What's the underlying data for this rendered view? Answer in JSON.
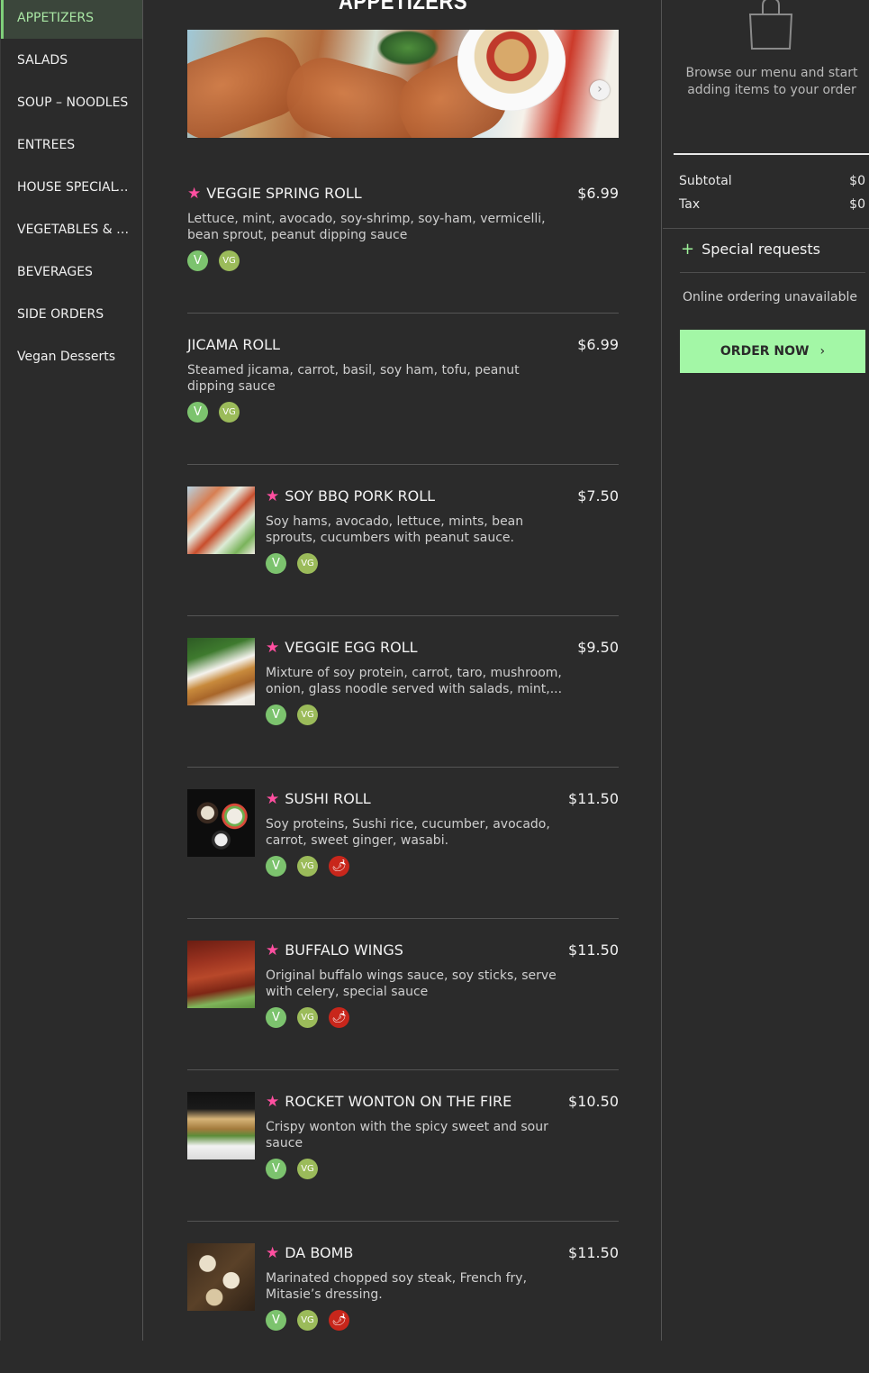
{
  "sidebar": {
    "items": [
      {
        "label": "APPETIZERS"
      },
      {
        "label": "SALADS"
      },
      {
        "label": "SOUP – NOODLES"
      },
      {
        "label": "ENTREES"
      },
      {
        "label": "HOUSE SPECIALTIES"
      },
      {
        "label": "VEGETABLES & TOFU"
      },
      {
        "label": "BEVERAGES"
      },
      {
        "label": "SIDE ORDERS"
      },
      {
        "label": "Vegan Desserts"
      }
    ]
  },
  "section": {
    "title": "APPETIZERS"
  },
  "menu_items": [
    {
      "name": "VEGGIE SPRING ROLL",
      "price": "$6.99",
      "desc": "Lettuce, mint, avocado, soy-shrimp, soy-ham, vermicelli, bean sprout, peanut dipping sauce",
      "badges": [
        "V",
        "VG"
      ]
    },
    {
      "name": "JICAMA ROLL",
      "price": "$6.99",
      "desc": "Steamed jicama, carrot, basil, soy ham, tofu, peanut dipping sauce",
      "badges": [
        "V",
        "VG"
      ]
    },
    {
      "name": "SOY BBQ PORK ROLL",
      "price": "$7.50",
      "desc": "Soy hams, avocado, lettuce, mints, bean sprouts, cucumbers with peanut sauce.",
      "badges": [
        "V",
        "VG"
      ]
    },
    {
      "name": "VEGGIE EGG ROLL",
      "price": "$9.50",
      "desc": "Mixture of soy protein, carrot, taro, mushroom, onion, glass noodle served with salads, mint,...",
      "badges": [
        "V",
        "VG"
      ]
    },
    {
      "name": "SUSHI ROLL",
      "price": "$11.50",
      "desc": "Soy proteins, Sushi rice, cucumber, avocado, carrot, sweet ginger, wasabi.",
      "badges": [
        "V",
        "VG",
        "spicy"
      ]
    },
    {
      "name": "BUFFALO WINGS",
      "price": "$11.50",
      "desc": "Original buffalo wings sauce, soy sticks, serve with celery, special sauce",
      "badges": [
        "V",
        "VG",
        "spicy"
      ]
    },
    {
      "name": "ROCKET WONTON ON THE FIRE",
      "price": "$10.50",
      "desc": "Crispy wonton with the spicy sweet and sour sauce",
      "badges": [
        "V",
        "VG"
      ]
    },
    {
      "name": "DA BOMB",
      "price": "$11.50",
      "desc": "Marinated chopped soy steak, French fry, Mitasie’s dressing.",
      "badges": [
        "V",
        "VG",
        "spicy"
      ]
    }
  ],
  "badges": {
    "v": "V",
    "vg": "VG",
    "spicy": "🌶"
  },
  "cart": {
    "empty_text": "Browse our menu and start adding items to your order",
    "subtotal_label": "Subtotal",
    "subtotal_value": "$0",
    "tax_label": "Tax",
    "tax_value": "$0",
    "special_label": "Special requests",
    "unavailable": "Online ordering unavailable",
    "order_button": "ORDER NOW"
  },
  "colors": {
    "accent": "#a3f7a6",
    "star": "#ff4fa0",
    "background": "#2b2b2b"
  }
}
